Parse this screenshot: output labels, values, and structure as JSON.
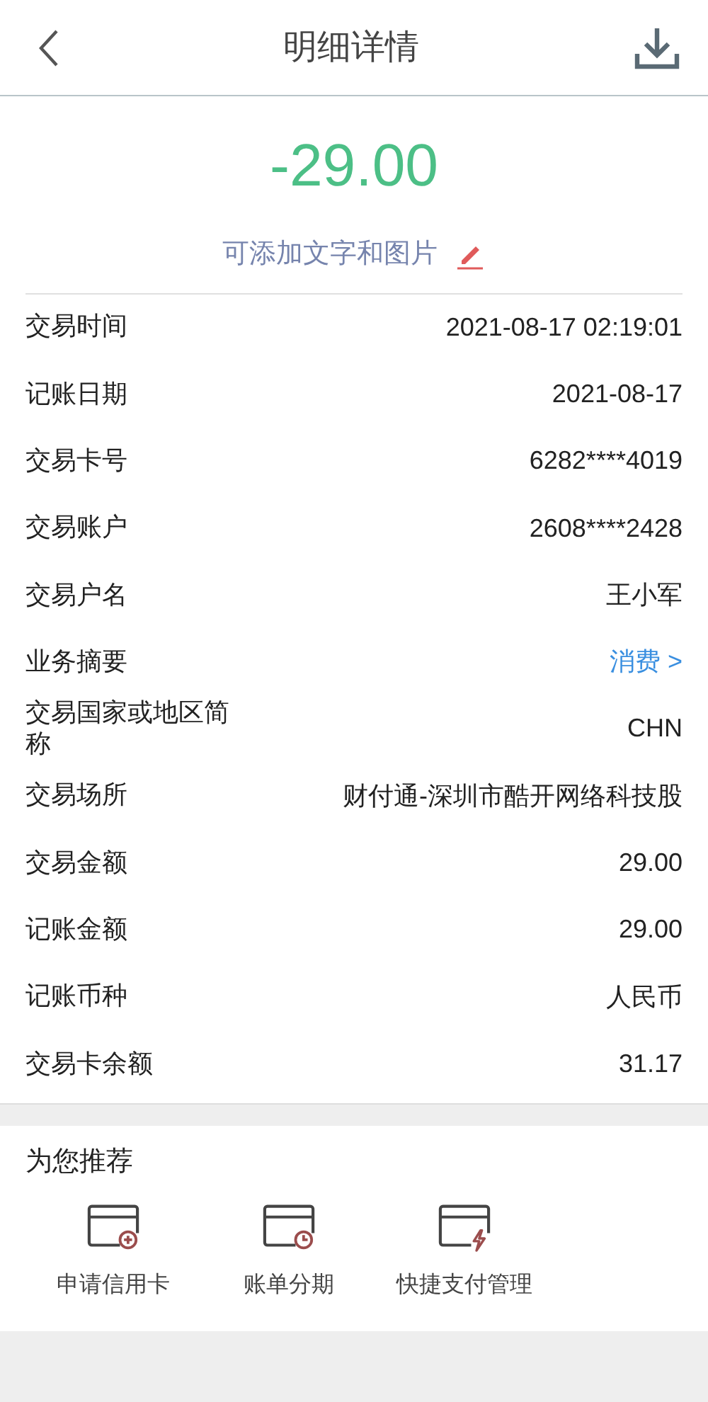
{
  "header": {
    "title": "明细详情"
  },
  "amount": "-29.00",
  "note_hint": "可添加文字和图片",
  "rows": [
    {
      "label": "交易时间",
      "value": "2021-08-17 02:19:01",
      "kind": "text"
    },
    {
      "label": "记账日期",
      "value": "2021-08-17",
      "kind": "text"
    },
    {
      "label": "交易卡号",
      "value": "6282****4019",
      "kind": "text"
    },
    {
      "label": "交易账户",
      "value": "2608****2428",
      "kind": "text"
    },
    {
      "label": "交易户名",
      "value": "王小军",
      "kind": "text"
    },
    {
      "label": "业务摘要",
      "value": "消费 >",
      "kind": "link"
    },
    {
      "label": "交易国家或地区简称",
      "value": "CHN",
      "kind": "text"
    },
    {
      "label": "交易场所",
      "value": "财付通-深圳市酷开网络科技股",
      "kind": "text"
    },
    {
      "label": "交易金额",
      "value": "29.00",
      "kind": "text"
    },
    {
      "label": "记账金额",
      "value": "29.00",
      "kind": "text"
    },
    {
      "label": "记账币种",
      "value": "人民币",
      "kind": "text"
    },
    {
      "label": "交易卡余额",
      "value": "31.17",
      "kind": "text"
    }
  ],
  "recommend": {
    "title": "为您推荐",
    "items": [
      {
        "label": "申请信用卡",
        "kind": "plus"
      },
      {
        "label": "账单分期",
        "kind": "clock"
      },
      {
        "label": "快捷支付管理",
        "kind": "bolt"
      }
    ]
  }
}
